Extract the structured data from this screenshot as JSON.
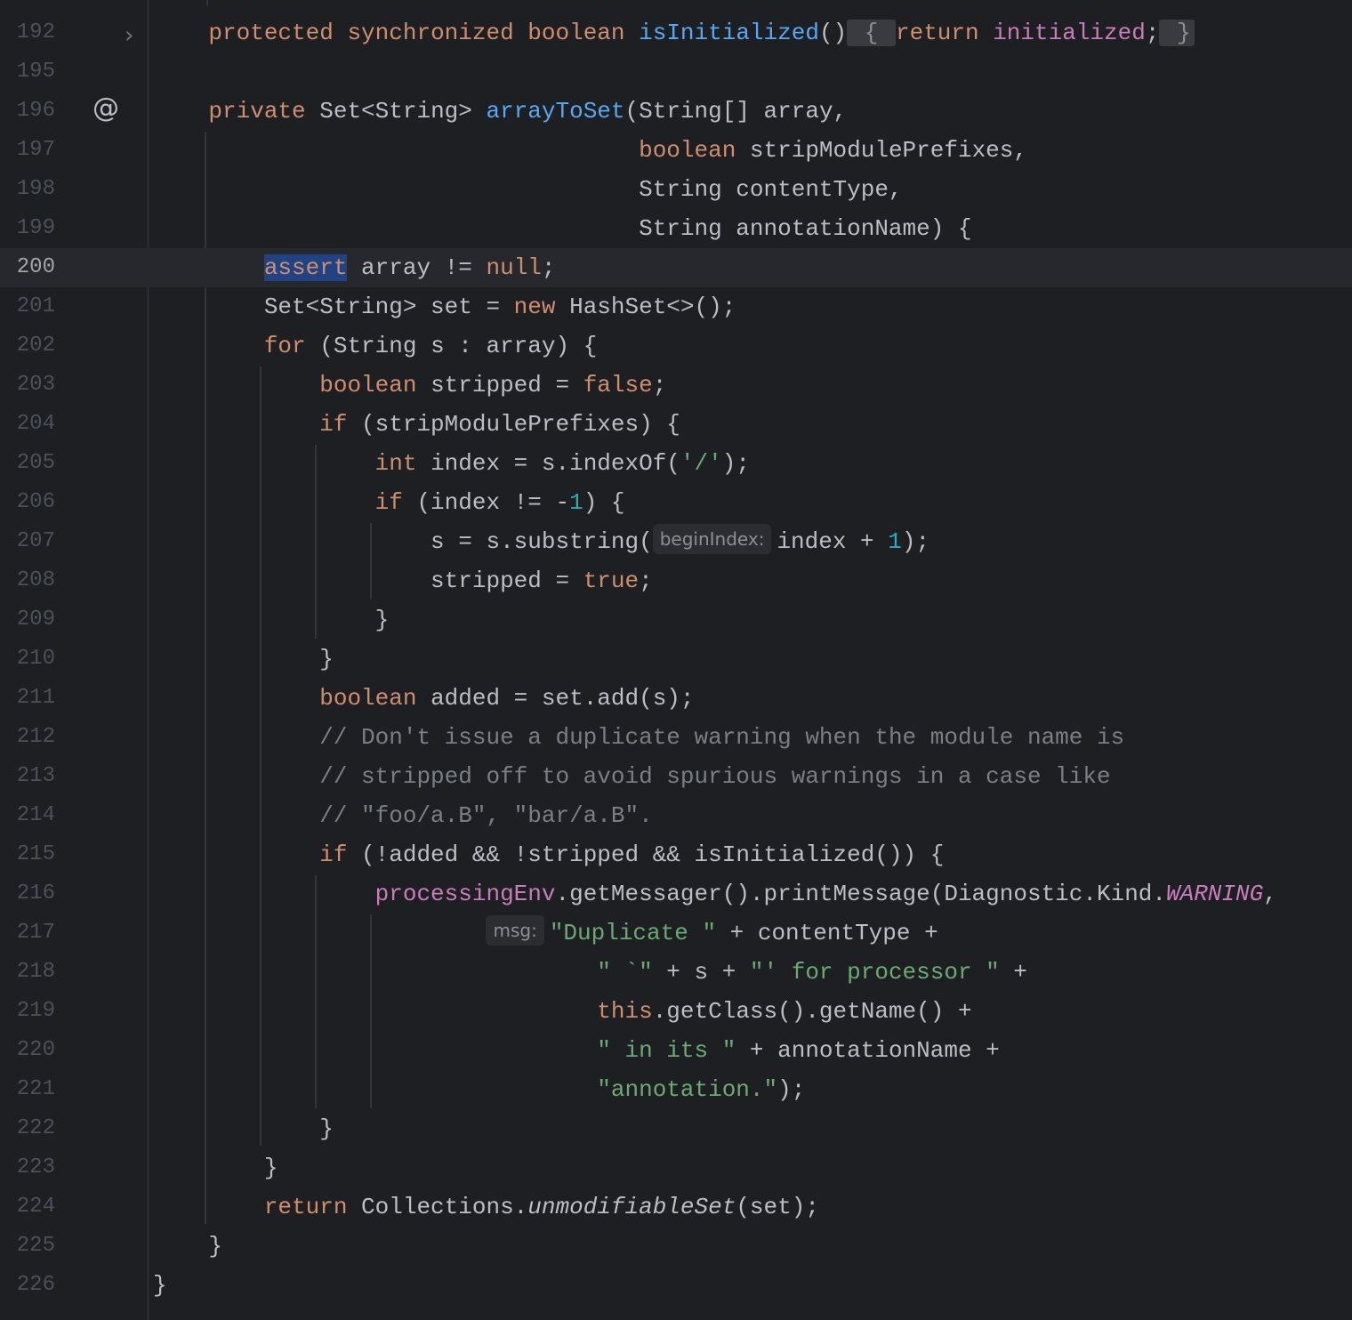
{
  "editor": {
    "language": "Java",
    "current_line": "200",
    "icons": {
      "fold": "chevron-right-icon",
      "override": "at-sign-icon"
    },
    "inlay_hints": {
      "begin_index": "beginIndex:",
      "msg": "msg:"
    },
    "line_numbers": [
      "192",
      "195",
      "196",
      "197",
      "198",
      "199",
      "200",
      "201",
      "202",
      "203",
      "204",
      "205",
      "206",
      "207",
      "208",
      "209",
      "210",
      "211",
      "212",
      "213",
      "214",
      "215",
      "216",
      "217",
      "218",
      "219",
      "220",
      "221",
      "222",
      "223",
      "224",
      "225",
      "226"
    ],
    "lines": [
      "    protected synchronized boolean isInitialized() { return initialized; }",
      "",
      "    private Set<String> arrayToSet(String[] array,",
      "                                   boolean stripModulePrefixes,",
      "                                   String contentType,",
      "                                   String annotationName) {",
      "        assert array != null;",
      "        Set<String> set = new HashSet<>();",
      "        for (String s : array) {",
      "            boolean stripped = false;",
      "            if (stripModulePrefixes) {",
      "                int index = s.indexOf('/');",
      "                if (index != -1) {",
      "                    s = s.substring(index + 1);",
      "                    stripped = true;",
      "                }",
      "            }",
      "            boolean added = set.add(s);",
      "            // Don't issue a duplicate warning when the module name is",
      "            // stripped off to avoid spurious warnings in a case like",
      "            // \"foo/a.B\", \"bar/a.B\".",
      "            if (!added && !stripped && isInitialized()) {",
      "                processingEnv.getMessager().printMessage(Diagnostic.Kind.WARNING,",
      "                        \"Duplicate \" + contentType +",
      "                                \" `\" + s + \"' for processor \" +",
      "                                this.getClass().getName() +",
      "                                \" in its \" + annotationName +",
      "                                \"annotation.\");",
      "            }",
      "        }",
      "        return Collections.unmodifiableSet(set);",
      "    }",
      "}"
    ]
  }
}
